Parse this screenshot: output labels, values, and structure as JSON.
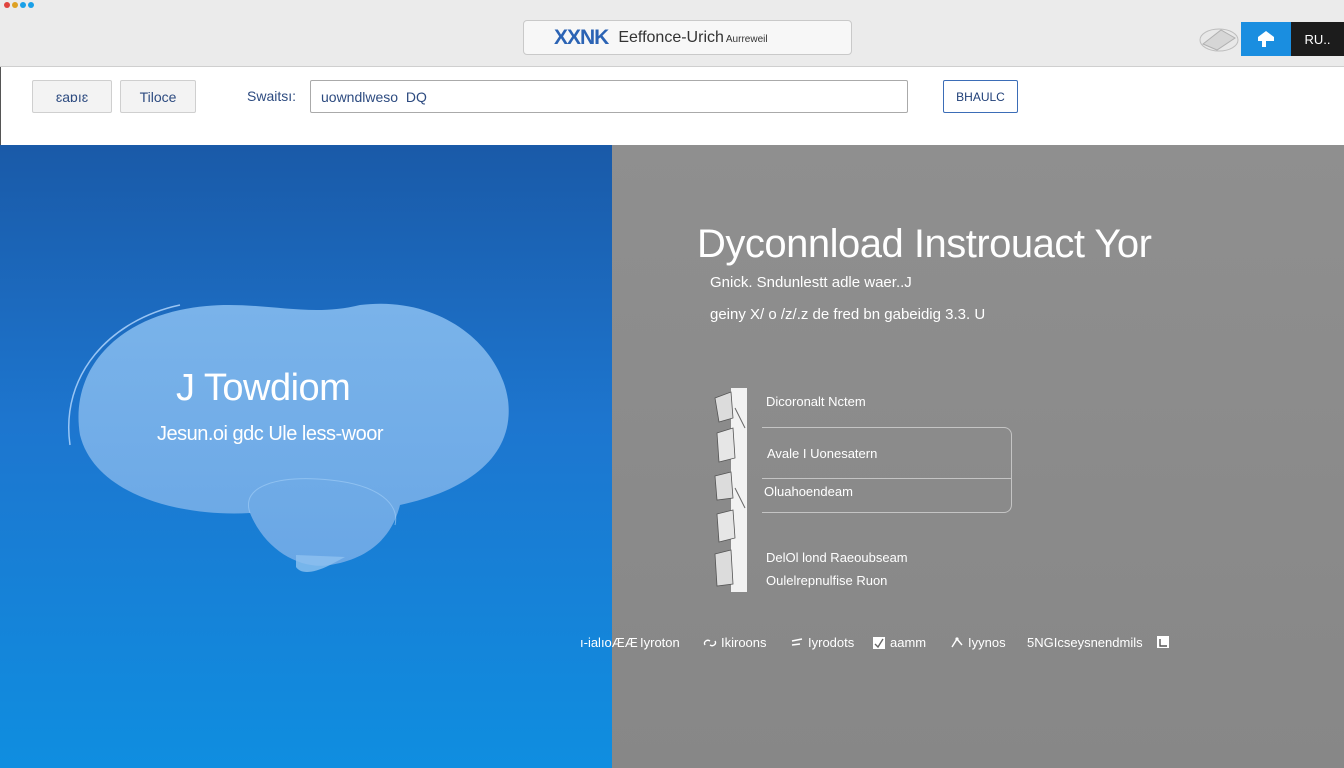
{
  "window": {
    "dot_colors": [
      "#e0443e",
      "#dea123",
      "#1aa0e8",
      "#1aa0e8"
    ]
  },
  "address_bar": {
    "brand": "XXNK",
    "title": "Eeffonce-Urich",
    "subtitle": "Aurreweil"
  },
  "top_right": {
    "cloud_icon": "cloud-icon",
    "blue_button_icon": "tag-icon",
    "dark_button_label": "RU.."
  },
  "toolbar": {
    "button1_label": "ɛaɒıɛ",
    "button2_label": "Tiloce",
    "search_label": "Swaitsı:",
    "search_value": "uowndlweso  DQ",
    "go_label": "BHAULC"
  },
  "hero_left": {
    "title": "J Towdiom",
    "subtitle": "Jesun.oi gdc Ule less-woor"
  },
  "hero_right": {
    "headline": "Dyconnload Instrouact Yor",
    "desc_line1": "Gnick. Sndunlestt adle waer..J",
    "desc_line2": "geiny X/ o /z/.z de fred bn gabeidig 3.3. U",
    "options": [
      "Dicoronalt Nctem",
      "Avale I Uonesatern",
      "Oluahoendeam",
      "DelOl lond Raeoubseam",
      "Oulelrepnulfise Ruon"
    ]
  },
  "footer": {
    "items": [
      {
        "icon": "windows-icon",
        "label": "ı-ialıoÆÆ"
      },
      {
        "icon": "none",
        "label": "Iyroton"
      },
      {
        "icon": "link-icon",
        "label": "Ikiroons"
      },
      {
        "icon": "pen-icon",
        "label": "Iyrodots"
      },
      {
        "icon": "check-icon",
        "label": "aamm"
      },
      {
        "icon": "share-icon",
        "label": "Iyynos"
      },
      {
        "icon": "none",
        "label": "5NGIcseysnendmils"
      },
      {
        "icon": "grid-icon",
        "label": ""
      }
    ]
  }
}
